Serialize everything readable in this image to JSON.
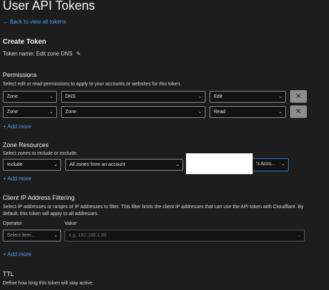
{
  "page": {
    "title": "User API Tokens",
    "back_link": "← Back to view all tokens"
  },
  "create": {
    "heading": "Create Token",
    "token_name_label": "Token name: Edit zone DNS",
    "edit_icon": "pencil-icon"
  },
  "permissions": {
    "heading": "Permissions",
    "description": "Select edit or read permissions to apply to your accounts or websites for this token.",
    "rows": [
      {
        "scope": "Zone",
        "item": "DNS",
        "level": "Edit"
      },
      {
        "scope": "Zone",
        "item": "Zone",
        "level": "Read"
      }
    ],
    "add_more": "+ Add more",
    "remove_icon": "close-icon"
  },
  "zone_resources": {
    "heading": "Zone Resources",
    "description": "Select zones to include or exclude.",
    "include": "Include",
    "zones": "All zones from an account",
    "account": "'s Acco...",
    "add_more": "+ Add more"
  },
  "ip_filter": {
    "heading": "Client IP Address Filtering",
    "description_line1": "Select IP addresses or ranges of IP addresses to filter. This filter limits the client IP addresses that can use the API token with Cloudflare. By",
    "description_line2": "default, this token will apply to all addresses.",
    "operator_label": "Operator",
    "value_label": "Value",
    "operator_placeholder": "Select item...",
    "value_placeholder": "e.g. 192.168.1.88",
    "add_more": "+ Add more"
  },
  "ttl": {
    "heading": "TTL",
    "description": "Define how long this token will stay active."
  },
  "colors": {
    "background": "#1d1d1d",
    "accent": "#4d9ff5",
    "focus": "#2f7de1"
  }
}
